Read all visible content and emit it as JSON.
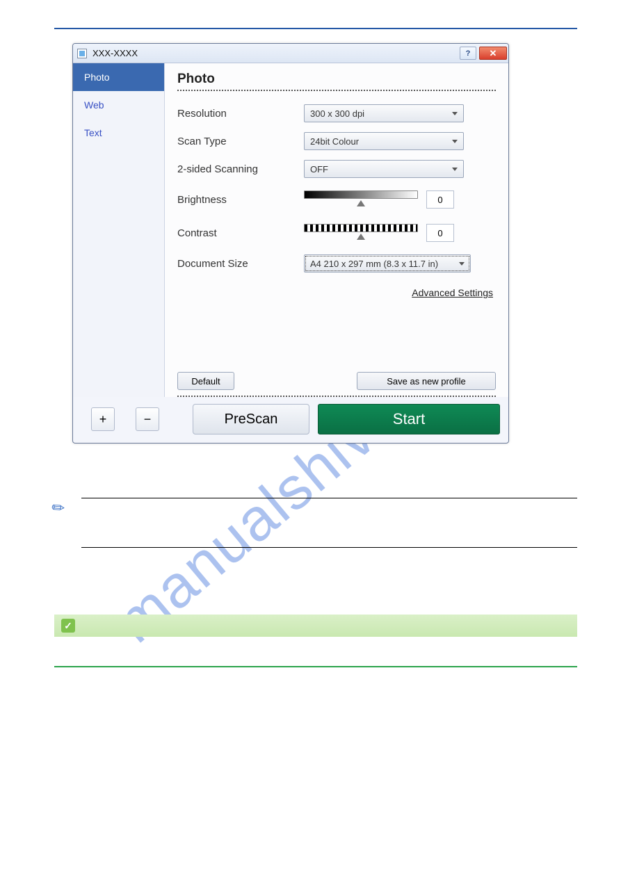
{
  "watermark": "manualshive.com",
  "dialog": {
    "title": "XXX-XXXX",
    "help_label": "?",
    "close_label": "✕",
    "sidebar": {
      "items": [
        {
          "label": "Photo"
        },
        {
          "label": "Web"
        },
        {
          "label": "Text"
        }
      ]
    },
    "section_title": "Photo",
    "fields": {
      "resolution": {
        "label": "Resolution",
        "value": "300 x 300 dpi"
      },
      "scan_type": {
        "label": "Scan Type",
        "value": "24bit Colour"
      },
      "two_sided": {
        "label": "2-sided Scanning",
        "value": "OFF"
      },
      "brightness": {
        "label": "Brightness",
        "value": "0"
      },
      "contrast": {
        "label": "Contrast",
        "value": "0"
      },
      "doc_size": {
        "label": "Document Size",
        "value": "A4 210 x 297 mm (8.3 x 11.7 in)"
      }
    },
    "advanced_link": "Advanced Settings",
    "buttons": {
      "default": "Default",
      "save_profile": "Save as new profile",
      "add": "+",
      "remove": "−",
      "prescan": "PreScan",
      "start": "Start"
    }
  },
  "check_label": "✓"
}
